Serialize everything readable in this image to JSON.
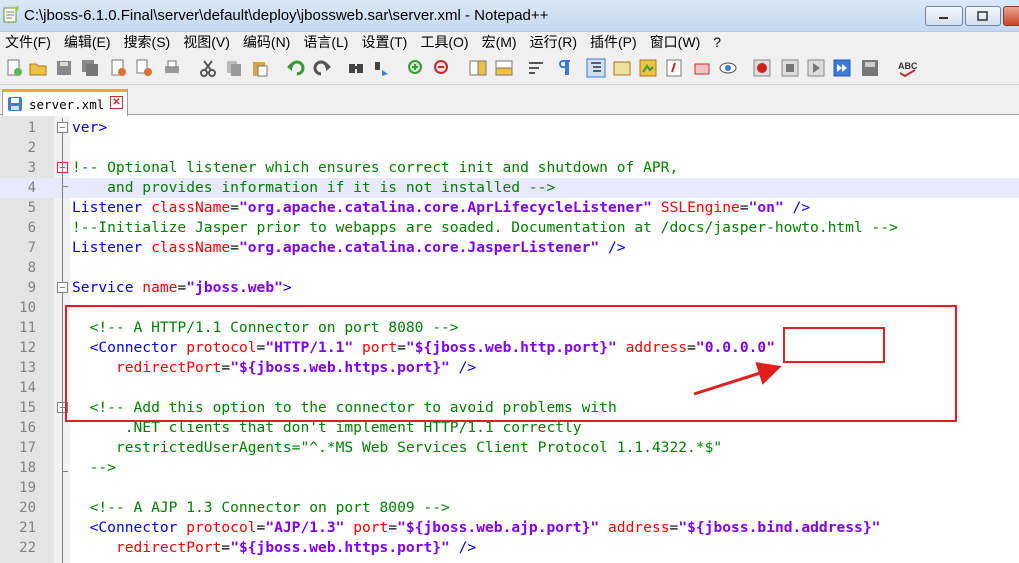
{
  "window": {
    "title": "C:\\jboss-6.1.0.Final\\server\\default\\deploy\\jbossweb.sar\\server.xml - Notepad++"
  },
  "menu": [
    "文件(F)",
    "编辑(E)",
    "搜索(S)",
    "视图(V)",
    "编码(N)",
    "语言(L)",
    "设置(T)",
    "工具(O)",
    "宏(M)",
    "运行(R)",
    "插件(P)",
    "窗口(W)",
    "?"
  ],
  "toolbar_icons": [
    "new-icon",
    "open-icon",
    "save-icon",
    "save-all-icon",
    "close-icon",
    "close-all-icon",
    "print-icon",
    "cut-icon",
    "copy-icon",
    "paste-icon",
    "undo-icon",
    "redo-icon",
    "find-icon",
    "replace-icon",
    "zoom-in-icon",
    "zoom-out-icon",
    "sync-v-icon",
    "sync-h-icon",
    "wrap-icon",
    "all-chars-icon",
    "indent-guide-icon",
    "udl-icon",
    "doc-map-icon",
    "function-list-icon",
    "folder-workspace-icon",
    "monitor-icon",
    "record-icon",
    "stop-icon",
    "play-icon",
    "play-multi-icon",
    "save-macro-icon",
    "spellcheck-icon"
  ],
  "tab": {
    "label": "server.xml"
  },
  "lines": [
    {
      "n": "1",
      "code": "ver>"
    },
    {
      "n": "2",
      "code": ""
    },
    {
      "n": "3",
      "code": "!-- Optional listener which ensures correct init and shutdown of APR,"
    },
    {
      "n": "4",
      "code": "    and provides information if it is not installed -->"
    },
    {
      "n": "5",
      "code": "Listener className=\"org.apache.catalina.core.AprLifecycleListener\" SSLEngine=\"on\" />"
    },
    {
      "n": "6",
      "code": "!--Initialize Jasper prior to webapps are soaded. Documentation at /docs/jasper-howto.html -->"
    },
    {
      "n": "7",
      "code": "Listener className=\"org.apache.catalina.core.JasperListener\" />"
    },
    {
      "n": "8",
      "code": ""
    },
    {
      "n": "9",
      "code": "Service name=\"jboss.web\">"
    },
    {
      "n": "10",
      "code": ""
    },
    {
      "n": "11",
      "code": "  <!-- A HTTP/1.1 Connector on port 8080 -->"
    },
    {
      "n": "12",
      "code": "  <Connector protocol=\"HTTP/1.1\" port=\"${jboss.web.http.port}\" address=\"0.0.0.0\""
    },
    {
      "n": "13",
      "code": "     redirectPort=\"${jboss.web.https.port}\" />"
    },
    {
      "n": "14",
      "code": ""
    },
    {
      "n": "15",
      "code": "  <!-- Add this option to the connector to avoid problems with"
    },
    {
      "n": "16",
      "code": "      .NET clients that don't implement HTTP/1.1 correctly"
    },
    {
      "n": "17",
      "code": "     restrictedUserAgents=\"^.*MS Web Services Client Protocol 1.1.4322.*$\""
    },
    {
      "n": "18",
      "code": "  -->"
    },
    {
      "n": "19",
      "code": ""
    },
    {
      "n": "20",
      "code": "  <!-- A AJP 1.3 Connector on port 8009 -->"
    },
    {
      "n": "21",
      "code": "  <Connector protocol=\"AJP/1.3\" port=\"${jboss.web.ajp.port}\" address=\"${jboss.bind.address}\""
    },
    {
      "n": "22",
      "code": "     redirectPort=\"${jboss.web.https.port}\" />"
    }
  ],
  "highlighted_line": "4",
  "colors": {
    "tag": "#0000ff",
    "attribute": "#ff0000",
    "value": "#8000ff",
    "comment": "#008000",
    "annotation": "#e02020"
  }
}
